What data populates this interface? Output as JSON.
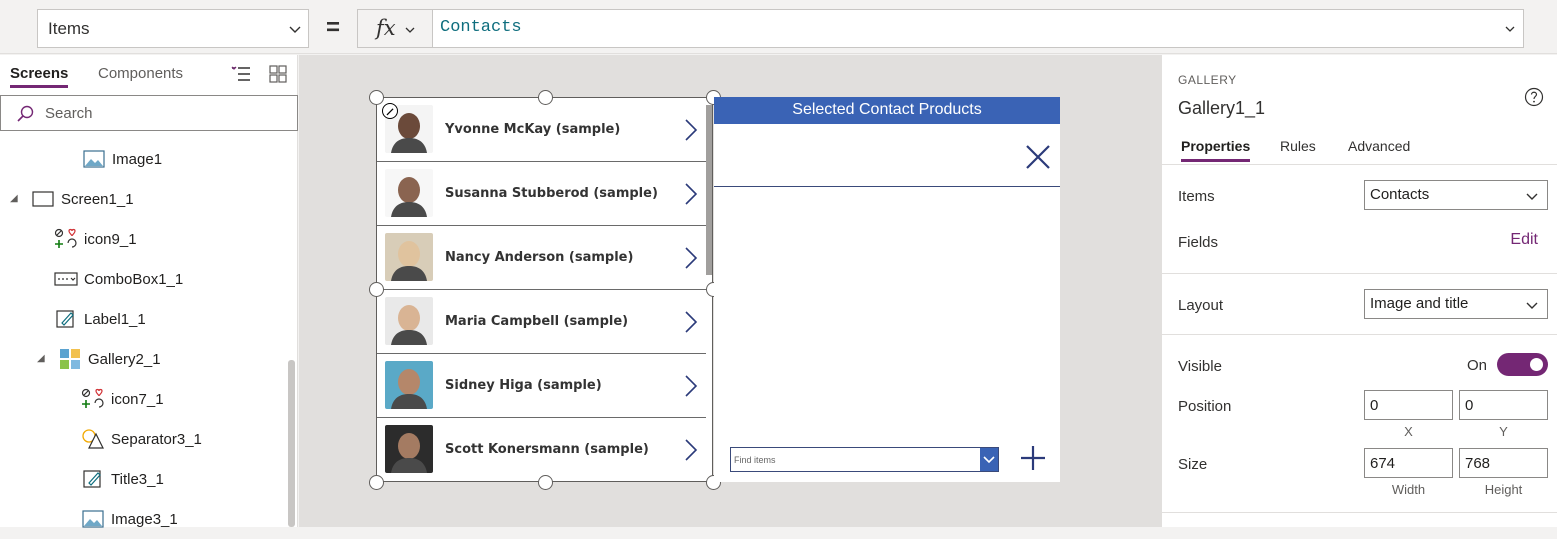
{
  "formula_bar": {
    "property": "Items",
    "equals": "=",
    "fx": "fx",
    "formula": "Contacts"
  },
  "tree": {
    "tabs": [
      "Screens",
      "Components"
    ],
    "search_placeholder": "Search",
    "items": [
      {
        "label": "Image1",
        "icon": "image-icon"
      },
      {
        "label": "Screen1_1",
        "icon": "screen-icon"
      },
      {
        "label": "icon9_1",
        "icon": "icons-icon"
      },
      {
        "label": "ComboBox1_1",
        "icon": "combobox-icon"
      },
      {
        "label": "Label1_1",
        "icon": "label-icon"
      },
      {
        "label": "Gallery2_1",
        "icon": "gallery-icon"
      },
      {
        "label": "icon7_1",
        "icon": "icons-icon"
      },
      {
        "label": "Separator3_1",
        "icon": "shapes-icon"
      },
      {
        "label": "Title3_1",
        "icon": "label-icon"
      },
      {
        "label": "Image3_1",
        "icon": "image-icon"
      }
    ]
  },
  "gallery": {
    "rows": [
      {
        "name": "Yvonne McKay (sample)",
        "skin": "#6b4a3a",
        "bg": "#f4f4f4"
      },
      {
        "name": "Susanna Stubberod (sample)",
        "skin": "#8a6450",
        "bg": "#f7f7f7"
      },
      {
        "name": "Nancy Anderson (sample)",
        "skin": "#e0c39e",
        "bg": "#d8cdb8"
      },
      {
        "name": "Maria Campbell (sample)",
        "skin": "#d9b494",
        "bg": "#e9e9e9"
      },
      {
        "name": "Sidney Higa (sample)",
        "skin": "#b5876a",
        "bg": "#5aa9c7"
      },
      {
        "name": "Scott Konersmann (sample)",
        "skin": "#a47b62",
        "bg": "#2c2c2c"
      }
    ]
  },
  "side_panel": {
    "header": "Selected Contact Products",
    "combo_placeholder": "Find items"
  },
  "props": {
    "type": "GALLERY",
    "name": "Gallery1_1",
    "tabs": [
      "Properties",
      "Rules",
      "Advanced"
    ],
    "items_label": "Items",
    "items_value": "Contacts",
    "fields_label": "Fields",
    "fields_link": "Edit",
    "layout_label": "Layout",
    "layout_value": "Image and title",
    "visible_label": "Visible",
    "visible_value": "On",
    "position_label": "Position",
    "position_x": "0",
    "position_y": "0",
    "x_cap": "X",
    "y_cap": "Y",
    "size_label": "Size",
    "width": "674",
    "height": "768",
    "width_cap": "Width",
    "height_cap": "Height"
  },
  "colors": {
    "accent": "#742774",
    "header_blue": "#3a63b5",
    "formula_text": "#0f6e7e"
  }
}
